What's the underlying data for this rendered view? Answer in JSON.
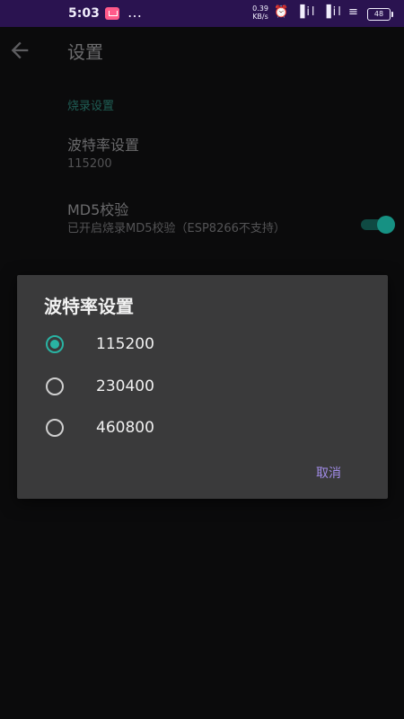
{
  "status_bar": {
    "time": "5:03",
    "more": "…",
    "net_speed_value": "0.39",
    "net_speed_unit": "KB/s",
    "icons_text": "⏰ ▐il ▐il ≡",
    "battery": "48"
  },
  "app_bar": {
    "title": "设置"
  },
  "settings": {
    "section_header": "烧录设置",
    "baud": {
      "title": "波特率设置",
      "summary": "115200"
    },
    "md5": {
      "title": "MD5校验",
      "summary": "已开启烧录MD5校验（ESP8266不支持）",
      "enabled": true
    }
  },
  "dialog": {
    "title": "波特率设置",
    "options": [
      {
        "label": "115200",
        "checked": true
      },
      {
        "label": "230400",
        "checked": false
      },
      {
        "label": "460800",
        "checked": false
      }
    ],
    "cancel_label": "取消"
  },
  "colors": {
    "status_bar_bg": "#2a1350",
    "accent_teal": "#29b3a3",
    "cancel_purple": "#a18ce8",
    "dialog_bg": "#3a3a3b"
  }
}
